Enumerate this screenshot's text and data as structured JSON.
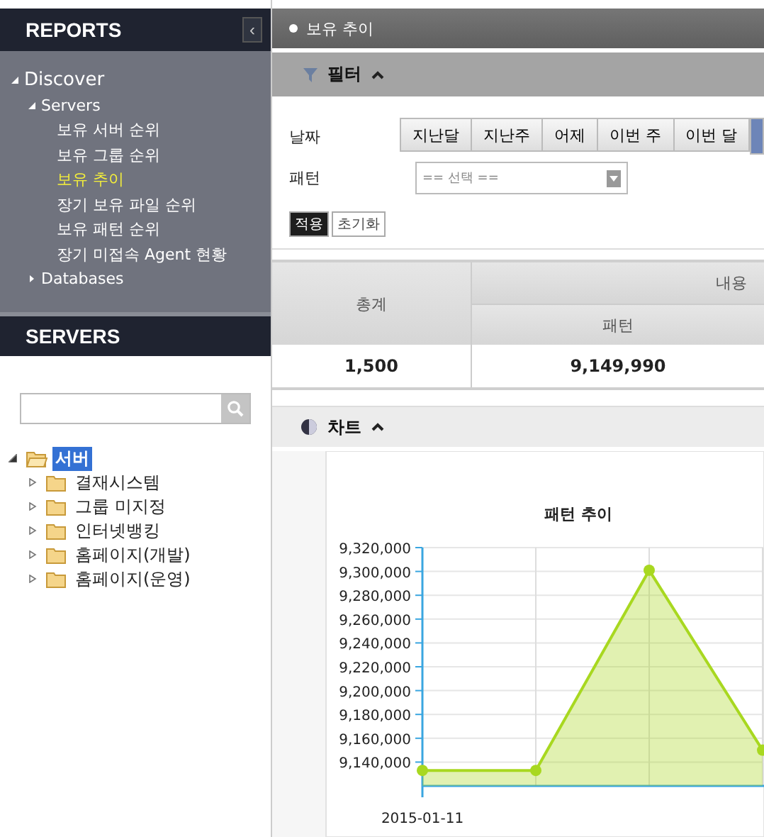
{
  "sidebar": {
    "reports_title": "REPORTS",
    "collapse_icon": "‹",
    "tree": [
      {
        "label": "Discover",
        "expanded": true,
        "children": [
          {
            "label": "Servers",
            "expanded": true,
            "children": [
              {
                "label": "보유 서버 순위",
                "selected": false
              },
              {
                "label": "보유 그룹 순위",
                "selected": false
              },
              {
                "label": "보유 추이",
                "selected": true
              },
              {
                "label": "장기 보유 파일 순위",
                "selected": false
              },
              {
                "label": "보유 패턴 순위",
                "selected": false
              },
              {
                "label": "장기 미접속 Agent 현황",
                "selected": false
              }
            ]
          },
          {
            "label": "Databases",
            "expanded": false
          }
        ]
      }
    ],
    "servers_title": "SERVERS",
    "server_tree": {
      "label": "서버",
      "expanded": true,
      "selected": true,
      "children": [
        {
          "label": "결재시스템",
          "expanded": false
        },
        {
          "label": "그룹 미지정",
          "expanded": false
        },
        {
          "label": "인터넷뱅킹",
          "expanded": false
        },
        {
          "label": "홈페이지(개발)",
          "expanded": false
        },
        {
          "label": "홈페이지(운영)",
          "expanded": false
        }
      ]
    }
  },
  "page_title": "보유 추이",
  "filter": {
    "title": "필터",
    "expanded": true,
    "date_label": "날짜",
    "date_buttons": [
      {
        "label": "지난달",
        "selected": false
      },
      {
        "label": "지난주",
        "selected": false
      },
      {
        "label": "어제",
        "selected": false
      },
      {
        "label": "이번 주",
        "selected": false
      },
      {
        "label": "이번 달",
        "selected": false
      },
      {
        "selected": true
      }
    ],
    "pattern_label": "패턴",
    "pattern_select": "== 선택 ==",
    "apply": "적용",
    "reset": "초기화"
  },
  "table": {
    "total_header": "총계",
    "group_header": "내용",
    "sub_header": "패턴",
    "rows": [
      {
        "total": "1,500",
        "pattern": "9,149,990"
      }
    ]
  },
  "chart_panel": {
    "title": "차트",
    "expanded": true,
    "chart_data": {
      "type": "area",
      "title": "패턴 추이",
      "grid": true,
      "categories": [
        "2015-01-11",
        null,
        null,
        null
      ],
      "series": [
        {
          "color": "#a8d820",
          "values": [
            9133000,
            9133000,
            9301000,
            9150000
          ]
        }
      ],
      "ylim": [
        9120000,
        9320000
      ],
      "yticks": [
        {
          "value": 9140000,
          "label": "9,140,000"
        },
        {
          "value": 9160000,
          "label": "9,160,000"
        },
        {
          "value": 9180000,
          "label": "9,180,000"
        },
        {
          "value": 9200000,
          "label": "9,200,000"
        },
        {
          "value": 9220000,
          "label": "9,220,000"
        },
        {
          "value": 9240000,
          "label": "9,240,000"
        },
        {
          "value": 9260000,
          "label": "9,260,000"
        },
        {
          "value": 9280000,
          "label": "9,280,000"
        },
        {
          "value": 9300000,
          "label": "9,300,000"
        },
        {
          "value": 9320000,
          "label": "9,320,000"
        }
      ]
    }
  }
}
